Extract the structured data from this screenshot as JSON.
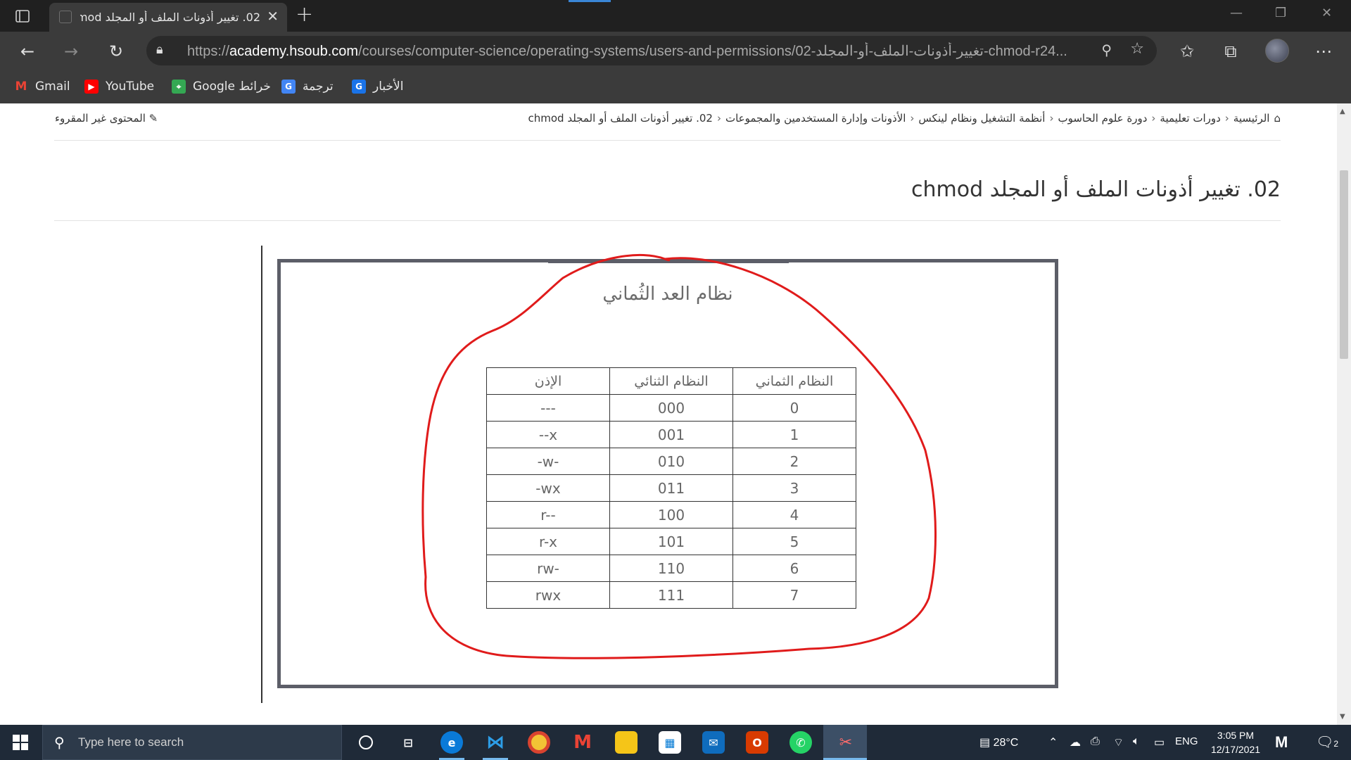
{
  "browser": {
    "tab_title": "02. تغيير أذونات الملف أو المجلد chmod",
    "url_prefix": "https://",
    "url_host": "academy.hsoub.com",
    "url_path": "/courses/computer-science/operating-systems/users-and-permissions/02-تغيير-أذونات-الملف-أو-المجلد-chmod-r24...",
    "bookmarks": [
      "Gmail",
      "YouTube",
      "Google خرائط",
      "ترجمة",
      "الأخبار"
    ]
  },
  "page": {
    "unread_label": "المحتوى غير المقروء",
    "breadcrumb": [
      "الرئيسية",
      "دورات تعليمية",
      "دورة علوم الحاسوب",
      "أنظمة التشغيل ونظام لينكس",
      "الأذونات وإدارة المستخدمين والمجموعات",
      "02. تغيير أذونات الملف أو المجلد chmod"
    ],
    "title": "02. تغيير أذونات الملف أو المجلد chmod",
    "figure": {
      "title": "نظام العد الثُماني",
      "headers": [
        "النظام الثماني",
        "النظام الثنائي",
        "الإذن"
      ],
      "rows": [
        [
          "0",
          "000",
          "---"
        ],
        [
          "1",
          "001",
          "--x"
        ],
        [
          "2",
          "010",
          "-w-"
        ],
        [
          "3",
          "011",
          "-wx"
        ],
        [
          "4",
          "100",
          "r--"
        ],
        [
          "5",
          "101",
          "r-x"
        ],
        [
          "6",
          "110",
          "rw-"
        ],
        [
          "7",
          "111",
          "rwx"
        ]
      ]
    }
  },
  "taskbar": {
    "search_placeholder": "Type here to search",
    "weather": "28°C",
    "language": "ENG",
    "time": "3:05 PM",
    "date": "12/17/2021",
    "notifications": "2"
  },
  "colors": {
    "annotation_red": "#e01b1b",
    "figure_border": "#5c5e68",
    "chrome_dark": "#3b3b3b"
  }
}
